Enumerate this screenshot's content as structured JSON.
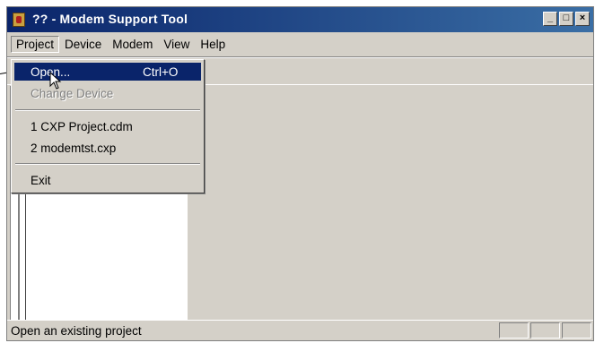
{
  "window": {
    "title": "?? - Modem Support Tool"
  },
  "caption_buttons": {
    "minimize": "_",
    "maximize": "□",
    "close": "×"
  },
  "menubar": {
    "items": [
      "Project",
      "Device",
      "Modem",
      "View",
      "Help"
    ],
    "active": "Project"
  },
  "project_menu": {
    "open": {
      "label": "Open...",
      "shortcut": "Ctrl+O"
    },
    "change_device": {
      "label": "Change Device"
    },
    "recent": [
      "1 CXP Project.cdm",
      "2 modemtst.cxp"
    ],
    "exit": {
      "label": "Exit"
    }
  },
  "statusbar": {
    "text": "Open an existing project"
  },
  "colors": {
    "titlebar": "#0a246a",
    "highlight": "#0a246a",
    "face": "#d4d0c8"
  },
  "icons": [
    "app-icon",
    "minimize-icon",
    "maximize-icon",
    "close-icon",
    "mouse-cursor-icon"
  ]
}
